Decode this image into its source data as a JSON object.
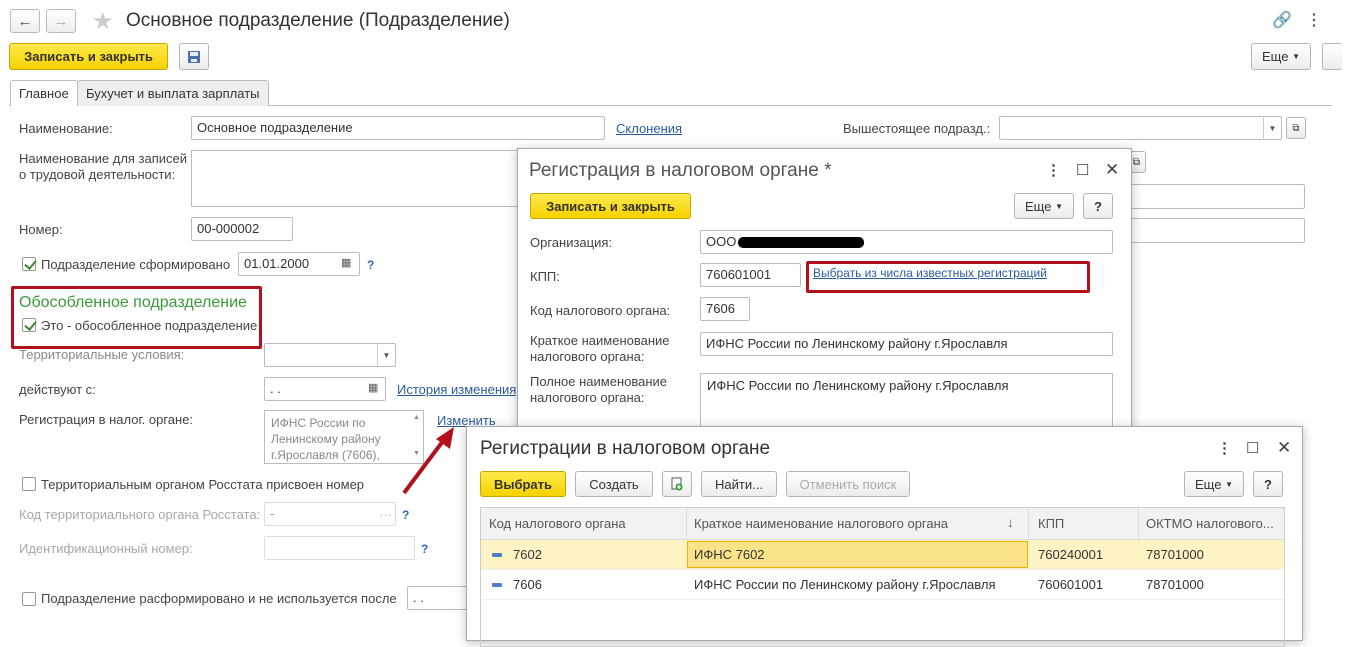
{
  "nav": {
    "back": "←",
    "forward": "→"
  },
  "header": {
    "title": "Основное подразделение (Подразделение)",
    "save_close": "Записать и закрыть",
    "more": "Еще"
  },
  "tabs": [
    "Главное",
    "Бухучет и выплата зарплаты"
  ],
  "form": {
    "name_label": "Наименование:",
    "name_value": "Основное подразделение",
    "declension_link": "Склонения",
    "parent_label": "Вышестоящее подразд.:",
    "parent_value": "",
    "labor_name_label_1": "Наименование для записей",
    "labor_name_label_2": "о трудовой деятельности:",
    "number_label": "Номер:",
    "number_value": "00-000002",
    "formed_label": "Подразделение сформировано",
    "formed_date": "01.01.2000",
    "separate_group_title": "Обособленное подразделение",
    "separate_checkbox_label": "Это - обособленное подразделение",
    "territorial_label": "Территориальные условия:",
    "effective_label": "действуют с:",
    "effective_value": " .  .",
    "history_link": "История изменения",
    "tax_reg_label": "Регистрация в налог. органе:",
    "tax_reg_value": "ИФНС России по Ленинскому району г.Ярославля (7606),",
    "change_link": "Изменить",
    "rosstat_checkbox_label": "Территориальным органом Росстата присвоен номер",
    "rosstat_code_label": "Код территориального органа Росстата:",
    "rosstat_code_value": "-",
    "id_number_label": "Идентификационный номер:",
    "disbanded_label": "Подразделение расформировано и не используется после",
    "disbanded_value": " .  ."
  },
  "registration_dialog": {
    "title": "Регистрация в налоговом органе *",
    "save_close": "Записать и закрыть",
    "more": "Еще",
    "help": "?",
    "org_label": "Организация:",
    "org_value": "ООО",
    "kpp_label": "КПП:",
    "kpp_value": "760601001",
    "choose_link": "Выбрать из числа известных регистраций",
    "tax_code_label": "Код налогового органа:",
    "tax_code_value": "7606",
    "short_name_label_1": "Краткое наименование",
    "short_name_label_2": "налогового органа:",
    "short_name_value": "ИФНС России по Ленинскому району г.Ярославля",
    "full_name_label_1": "Полное наименование",
    "full_name_label_2": "налогового органа:",
    "full_name_value": "ИФНС России по Ленинскому району г.Ярославля"
  },
  "registrations_list": {
    "title": "Регистрации в налоговом органе",
    "select": "Выбрать",
    "create": "Создать",
    "find": "Найти...",
    "cancel_search": "Отменить поиск",
    "more": "Еще",
    "help": "?",
    "columns": [
      "Код налогового органа",
      "Краткое наименование налогового органа",
      "КПП",
      "ОКТМО налогового..."
    ],
    "sort_indicator": "↓",
    "rows": [
      {
        "code": "7602",
        "name": "ИФНС 7602",
        "kpp": "760240001",
        "oktmo": "78701000"
      },
      {
        "code": "7606",
        "name": "ИФНС России по Ленинскому району г.Ярославля",
        "kpp": "760601001",
        "oktmo": "78701000"
      }
    ]
  },
  "colors": {
    "accent_yellow": "#f6d200",
    "highlight_red": "#b3101d",
    "group_green": "#3a9a3a",
    "selected_row": "#fdf3c4"
  }
}
